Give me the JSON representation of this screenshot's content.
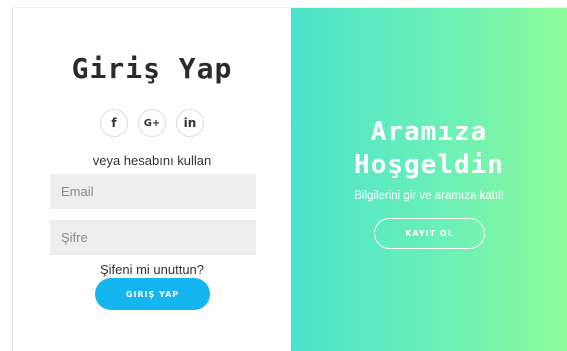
{
  "signin": {
    "title": "Giriş Yap",
    "social": [
      {
        "name": "facebook",
        "glyph": "f"
      },
      {
        "name": "google-plus",
        "glyph": "G+"
      },
      {
        "name": "linkedin",
        "glyph": "in"
      }
    ],
    "or_text": "veya hesabını kullan",
    "email_placeholder": "Email",
    "password_placeholder": "Şifre",
    "forgot_text": "Şifeni mi unuttun?",
    "button_label": "GIRIŞ YAP"
  },
  "welcome": {
    "title_line1": "Aramıza",
    "title_line2": "Hoşgeldin",
    "subtitle": "Bilgilerini gir ve aramıza katıl!",
    "button_label": "KAYIT OL"
  },
  "colors": {
    "primary_button": "#14b6f0",
    "gradient_start": "#4be3cc",
    "gradient_end": "#8efb9a"
  }
}
